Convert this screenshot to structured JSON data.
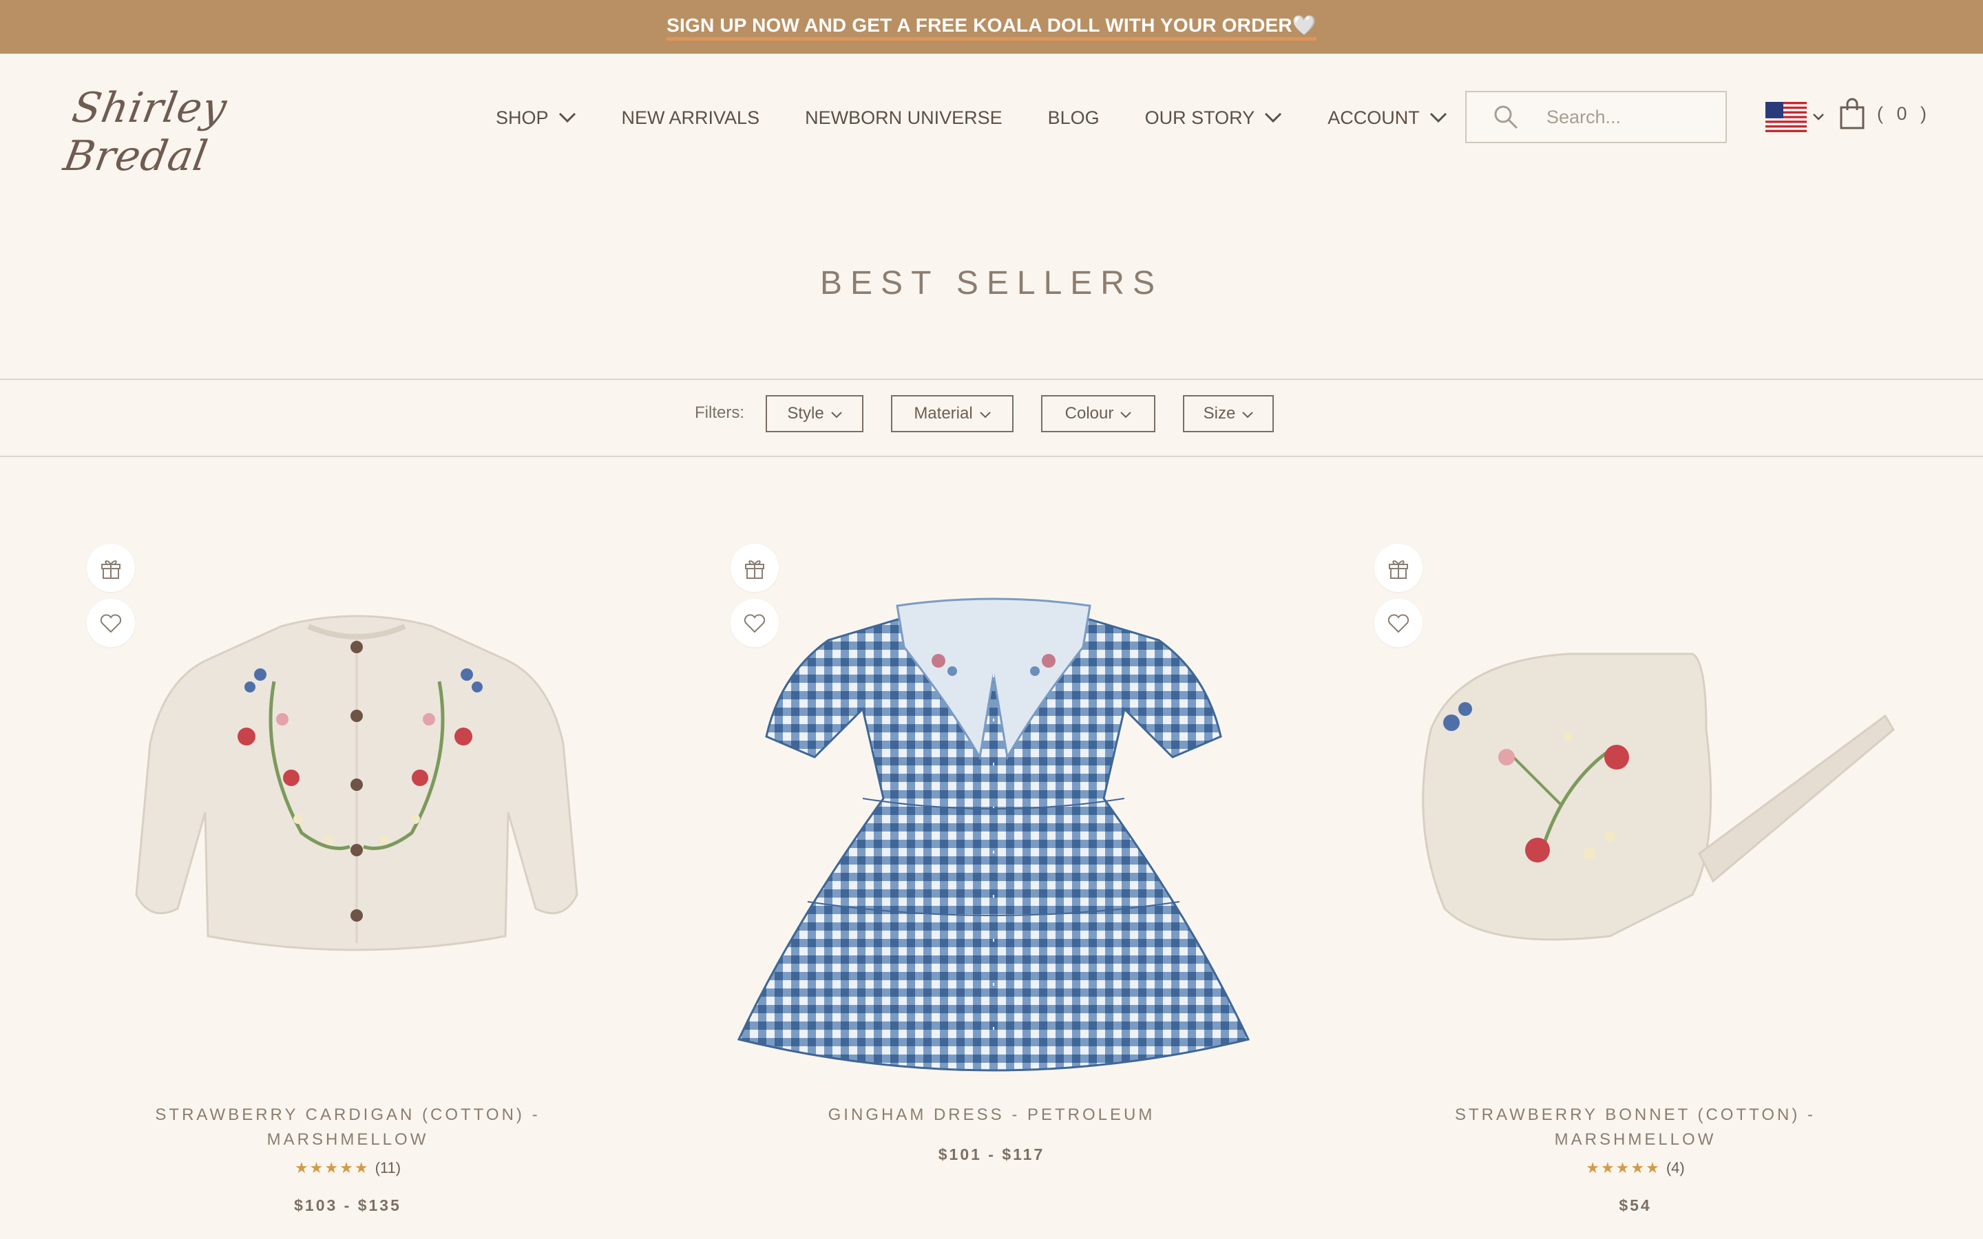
{
  "announcement": {
    "text": "SIGN UP NOW AND GET A FREE KOALA DOLL WITH YOUR ORDER🤍"
  },
  "header": {
    "logo_text": "Shirley Bredal",
    "nav": [
      {
        "label": "SHOP",
        "has_dropdown": true
      },
      {
        "label": "NEW ARRIVALS",
        "has_dropdown": false
      },
      {
        "label": "NEWBORN UNIVERSE",
        "has_dropdown": false
      },
      {
        "label": "BLOG",
        "has_dropdown": false
      },
      {
        "label": "OUR STORY",
        "has_dropdown": true
      },
      {
        "label": "ACCOUNT",
        "has_dropdown": true
      }
    ],
    "search": {
      "placeholder": "Search...",
      "value": ""
    },
    "country_flag": "us-flag-icon",
    "cart_count": "( 0 )"
  },
  "page": {
    "title": "BEST SELLERS",
    "filters_label": "Filters:",
    "filters": [
      "Style",
      "Material",
      "Colour",
      "Size"
    ]
  },
  "products": [
    {
      "name": "STRAWBERRY CARDIGAN (COTTON) - MARSHMELLOW",
      "name_line1": "STRAWBERRY CARDIGAN (COTTON) -",
      "name_line2": "MARSHMELLOW",
      "rating_stars": 5,
      "review_count": "(11)",
      "price": "$103 - $135"
    },
    {
      "name": "GINGHAM DRESS - PETROLEUM",
      "name_line1": "GINGHAM DRESS - PETROLEUM",
      "price": "$101 - $117"
    },
    {
      "name": "STRAWBERRY BONNET (COTTON) - MARSHMELLOW",
      "name_line1": "STRAWBERRY BONNET (COTTON) -",
      "name_line2": "MARSHMELLOW",
      "rating_stars": 5,
      "review_count": "(4)",
      "price": "$54"
    }
  ],
  "colors": {
    "announcement_bg": "#b99063",
    "page_bg": "#faf6ef",
    "star": "#d39a48",
    "gingham": "#4e78a8"
  }
}
